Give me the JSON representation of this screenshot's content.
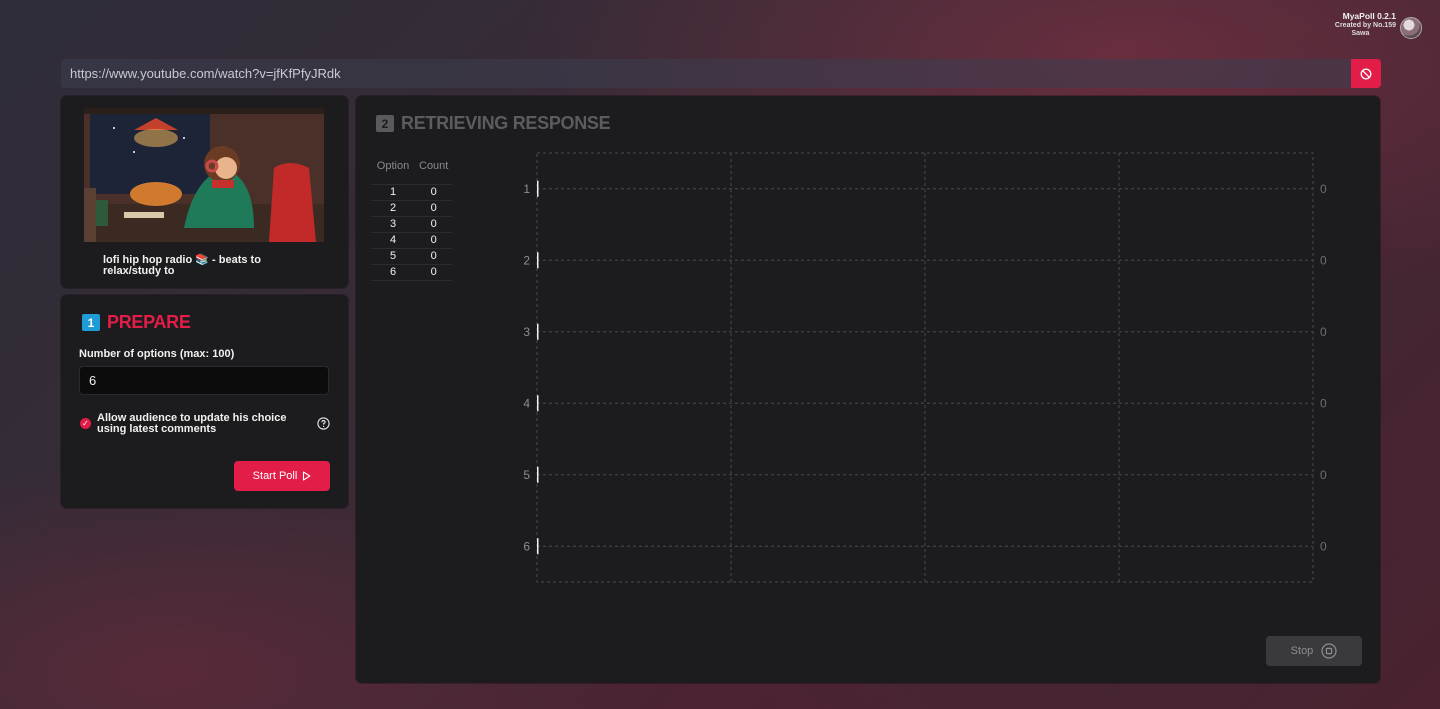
{
  "app": {
    "name": "MyaPoll 0.2.1",
    "credit_line1": "Created by No.159",
    "credit_line2": "Sawa"
  },
  "url_bar": {
    "value": "https://www.youtube.com/watch?v=jfKfPfyJRdk",
    "clear_icon": "ban-icon"
  },
  "video": {
    "title": "lofi hip hop radio 📚 - beats to relax/study to"
  },
  "prepare": {
    "step_number": "1",
    "title": "PREPARE",
    "options_label": "Number of options (max: 100)",
    "options_value": "6",
    "allow_update_label": "Allow audience to update his choice using latest comments",
    "allow_update_checked": true,
    "start_button": "Start Poll",
    "start_icon": "play-outline-icon"
  },
  "response": {
    "step_number": "2",
    "title": "RETRIEVING RESPONSE",
    "table_headers": [
      "Option",
      "Count"
    ],
    "rows": [
      {
        "option": "1",
        "count": "0"
      },
      {
        "option": "2",
        "count": "0"
      },
      {
        "option": "3",
        "count": "0"
      },
      {
        "option": "4",
        "count": "0"
      },
      {
        "option": "5",
        "count": "0"
      },
      {
        "option": "6",
        "count": "0"
      }
    ],
    "stop_button": "Stop",
    "stop_icon": "stop-circle-icon"
  },
  "chart_data": {
    "type": "bar",
    "orientation": "horizontal",
    "categories": [
      "1",
      "2",
      "3",
      "4",
      "5",
      "6"
    ],
    "values": [
      0,
      0,
      0,
      0,
      0,
      0
    ],
    "value_labels": [
      "0",
      "0",
      "0",
      "0",
      "0",
      "0"
    ],
    "grid": true,
    "grid_style": "dashed"
  },
  "colors": {
    "accent": "#e11d48",
    "step1_badge": "#1f9bd7",
    "panel": "#1c1c1e"
  }
}
